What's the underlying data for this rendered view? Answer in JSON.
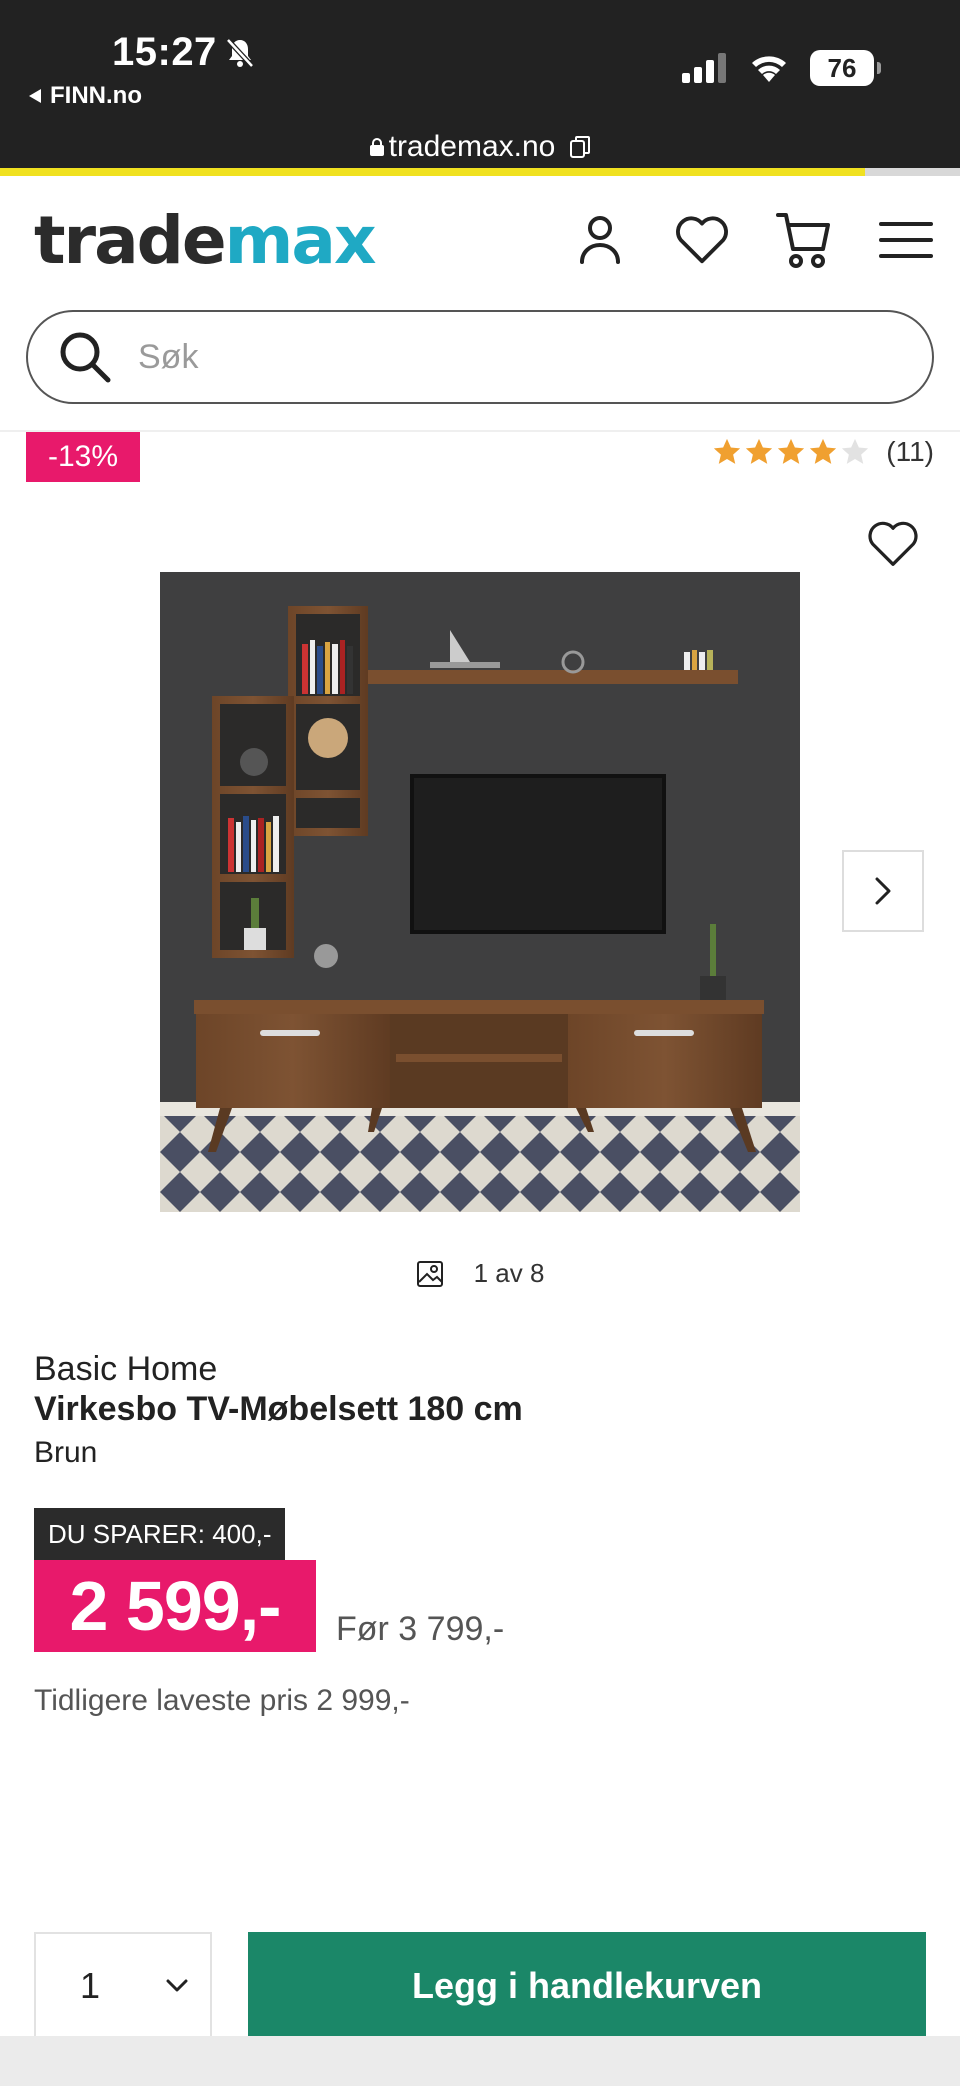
{
  "status_bar": {
    "time": "15:27",
    "back_app": "FINN.no",
    "battery": "76"
  },
  "browser": {
    "url": "trademax.no"
  },
  "header": {
    "logo_part1": "trade",
    "logo_part2": "max"
  },
  "search": {
    "placeholder": "Søk"
  },
  "product": {
    "discount_badge": "-13%",
    "rating_value": 4,
    "rating_max": 5,
    "rating_count": "(11)",
    "image_counter": "1 av 8",
    "brand": "Basic Home",
    "title": "Virkesbo TV-Møbelsett 180 cm",
    "variant": "Brun",
    "saving_label": "DU SPARER: 400,-",
    "price": "2 599,-",
    "before_price": "Før 3 799,-",
    "lowest_price": "Tidligere laveste pris 2 999,-"
  },
  "cart": {
    "quantity": "1",
    "add_label": "Legg i handlekurven"
  },
  "colors": {
    "brand_blue": "#1fa9c4",
    "sale_pink": "#e8196b",
    "cta_green": "#1b8768",
    "star_orange": "#f0a030"
  },
  "icons": [
    "user-icon",
    "heart-icon",
    "cart-icon",
    "menu-icon",
    "search-icon",
    "image-icon",
    "chevron-right-icon",
    "chevron-down-icon"
  ]
}
